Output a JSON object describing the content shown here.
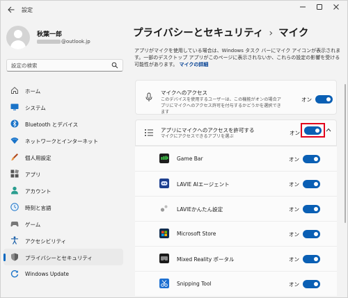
{
  "window": {
    "title": "設定",
    "controls": [
      "minimize",
      "maximize",
      "close"
    ]
  },
  "profile": {
    "name": "秋葉一郎",
    "email_suffix": "@outlook.jp"
  },
  "search": {
    "placeholder": "設定の検索"
  },
  "sidebar": {
    "items": [
      {
        "label": "ホーム",
        "icon": "home-icon"
      },
      {
        "label": "システム",
        "icon": "system-icon"
      },
      {
        "label": "Bluetooth とデバイス",
        "icon": "bluetooth-icon"
      },
      {
        "label": "ネットワークとインターネット",
        "icon": "network-icon"
      },
      {
        "label": "個人用設定",
        "icon": "personalization-icon"
      },
      {
        "label": "アプリ",
        "icon": "apps-icon"
      },
      {
        "label": "アカウント",
        "icon": "account-icon"
      },
      {
        "label": "時刻と言語",
        "icon": "time-language-icon"
      },
      {
        "label": "ゲーム",
        "icon": "gaming-icon"
      },
      {
        "label": "アクセシビリティ",
        "icon": "accessibility-icon"
      },
      {
        "label": "プライバシーとセキュリティ",
        "icon": "privacy-shield-icon",
        "active": true
      },
      {
        "label": "Windows Update",
        "icon": "windows-update-icon"
      }
    ],
    "accent": "#0067c0"
  },
  "main": {
    "breadcrumb_parent": "プライバシーとセキュリティ",
    "breadcrumb_separator": "›",
    "breadcrumb_current": "マイク",
    "description": "アプリがマイクを使用している場合は、Windows タスク バーにマイク アイコンが表示されます。一部のデスクトップ アプリがこのページに表示されないか、これらの設定の影響を受ける可能性があります。",
    "details_link": "マイクの詳細",
    "mic_access": {
      "title": "マイクへのアクセス",
      "subtitle": "このデバイスを使用するユーザーは、この機能がオンの場合アプリにマイクへのアクセス許可を付与するかどうかを選択できます",
      "state": "オン",
      "on": true
    },
    "app_access": {
      "title": "アプリにマイクへのアクセスを許可する",
      "subtitle": "マイクにアクセスできるアプリを選ぶ",
      "state": "オン",
      "on": true,
      "expanded": true,
      "highlight_color": "#e3001b"
    },
    "apps": [
      {
        "name": "Game Bar",
        "state": "オン",
        "on": true
      },
      {
        "name": "LAVIE AIエージェント",
        "state": "オン",
        "on": true
      },
      {
        "name": "LAVIEかんたん設定",
        "state": "オン",
        "on": true
      },
      {
        "name": "Microsoft Store",
        "state": "オン",
        "on": true
      },
      {
        "name": "Mixed Reality ポータル",
        "state": "オン",
        "on": true
      },
      {
        "name": "Snipping Tool",
        "state": "オン",
        "on": true
      }
    ],
    "toggle_color": "#0a5fb4"
  }
}
